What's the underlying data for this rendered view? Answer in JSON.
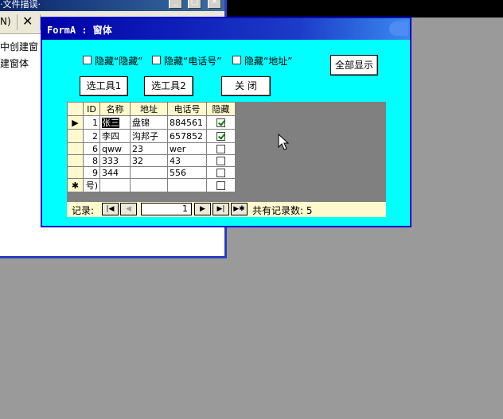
{
  "background_window": {
    "title": "·文件描误·",
    "toolbar_text": "N)",
    "close_glyph": "✕",
    "lines": [
      "中创建窗",
      "建窗体"
    ]
  },
  "form": {
    "title": "FormA : 窗体",
    "checkboxes": [
      {
        "label": "隐藏“隐藏”",
        "checked": false
      },
      {
        "label": "隐藏“电话号”",
        "checked": false
      },
      {
        "label": "隐藏“地址”",
        "checked": false
      }
    ],
    "buttons": {
      "show_all": "全部显示",
      "tool1": "选工具1",
      "tool2": "选工具2",
      "close": "关 闭"
    },
    "table": {
      "columns": [
        "ID",
        "名称",
        "地址",
        "电话号",
        "隐藏"
      ],
      "rows": [
        {
          "selector": "▶",
          "id": "1",
          "name": "张三",
          "addr": "盘锦",
          "phone": "884561",
          "hidden": true
        },
        {
          "selector": "",
          "id": "2",
          "name": "李四",
          "addr": "沟邦子",
          "phone": "657852",
          "hidden": true
        },
        {
          "selector": "",
          "id": "6",
          "name": "qww",
          "addr": "23",
          "phone": "wer",
          "hidden": false
        },
        {
          "selector": "",
          "id": "8",
          "name": "333",
          "addr": "32",
          "phone": "43",
          "hidden": false
        },
        {
          "selector": "",
          "id": "9",
          "name": "344",
          "addr": "",
          "phone": "556",
          "hidden": false
        },
        {
          "selector": "✱",
          "id": "号)",
          "name": "",
          "addr": "",
          "phone": "",
          "hidden": false
        }
      ]
    },
    "navigator": {
      "label": "记录:",
      "current": "1",
      "total_text": "共有记录数: 5",
      "first_icon": "first-record-icon",
      "prev_icon": "prev-record-icon",
      "next_icon": "next-record-icon",
      "last_icon": "last-record-icon",
      "new_icon": "new-record-icon"
    }
  }
}
